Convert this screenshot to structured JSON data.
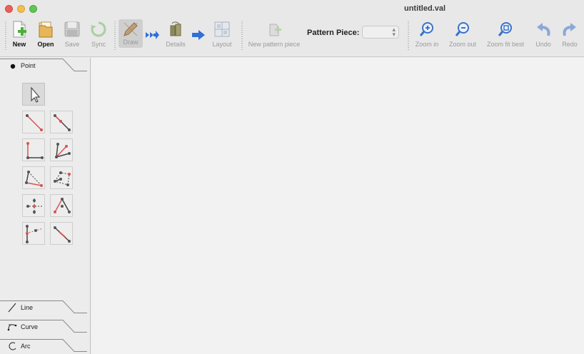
{
  "window": {
    "title": "untitled.val"
  },
  "toolbar": {
    "new": "New",
    "open": "Open",
    "save": "Save",
    "sync": "Sync",
    "draw": "Draw",
    "details": "Details",
    "layout": "Layout",
    "new_pattern_piece": "New pattern piece",
    "pattern_piece_label": "Pattern Piece:",
    "pattern_piece_value": "",
    "zoom_in": "Zoom in",
    "zoom_out": "Zoom out",
    "zoom_fit_best": "Zoom fit best",
    "undo": "Undo",
    "redo": "Redo"
  },
  "tools": {
    "sections": {
      "point": "Point",
      "line": "Line",
      "curve": "Curve",
      "arc": "Arc"
    },
    "point_tools": [
      "arrow-pointer-icon",
      "point-at-distance-angle-icon",
      "point-along-line-icon",
      "point-shoulder-icon",
      "point-normal-icon",
      "point-bisector-icon",
      "point-triangle-icon",
      "point-height-icon",
      "point-of-contact-icon",
      "line-intersect-icon",
      "point-intersect-axis-icon",
      "point-of-intersection-icon"
    ]
  },
  "colors": {
    "accent_red": "#d9534f",
    "point_gray": "#555555",
    "arrow_blue": "#2f6fd6"
  }
}
